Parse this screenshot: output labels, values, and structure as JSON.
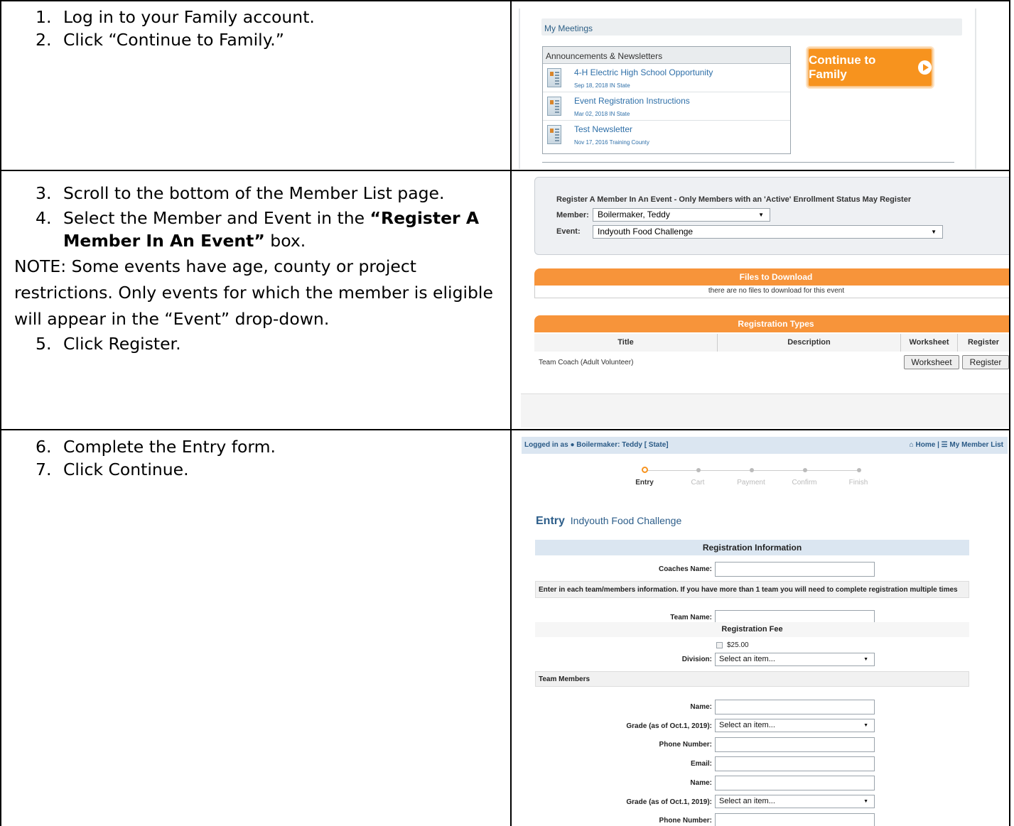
{
  "steps": {
    "s1_num": "1.",
    "s1": "Log in to your Family account.",
    "s2_num": "2.",
    "s2": "Click “Continue to Family.”",
    "s3_num": "3.",
    "s3": "Scroll to the bottom of the Member List page.",
    "s4_num": "4.",
    "s4_pre": "Select the Member and Event in the ",
    "s4_bold": "“Register A Member In An Event”",
    "s4_post": " box.",
    "note": "NOTE: Some events have age, county or project restrictions. Only events for which the member is eligible will appear in the “Event” drop-down.",
    "s5_num": "5.",
    "s5": "Click Register.",
    "s6_num": "6.",
    "s6": "Complete the Entry form.",
    "s7_num": "7.",
    "s7": "Click Continue."
  },
  "shot1": {
    "my_meetings": "My Meetings",
    "announcements_header": "Announcements & Newsletters",
    "items": [
      {
        "title": "4-H Electric High School Opportunity",
        "meta": "Sep 18, 2018 IN State"
      },
      {
        "title": "Event Registration Instructions",
        "meta": "Mar 02, 2018 IN State"
      },
      {
        "title": "Test Newsletter",
        "meta": "Nov 17, 2016 Training County"
      }
    ],
    "continue_button": "Continue to Family"
  },
  "shot2": {
    "register_title": "Register A Member In An Event - Only Members with an 'Active' Enrollment Status May Register",
    "member_label": "Member:",
    "member_value": "Boilermaker, Teddy",
    "event_label": "Event:",
    "event_value": "Indyouth Food Challenge",
    "files_header": "Files to Download",
    "files_msg": "there are no files to download for this event",
    "reg_types_header": "Registration Types",
    "col_title": "Title",
    "col_description": "Description",
    "col_worksheet": "Worksheet",
    "col_register": "Register",
    "row_title": "Team Coach (Adult Volunteer)",
    "worksheet_button": "Worksheet",
    "register_button": "Register"
  },
  "shot3": {
    "logged_in": "Logged in as",
    "user": "Boilermaker: Teddy",
    "role": "[ State]",
    "home": "Home",
    "sep": "|",
    "member_list": "My Member List",
    "progress": [
      "Entry",
      "Cart",
      "Payment",
      "Confirm",
      "Finish"
    ],
    "entry_word": "Entry",
    "entry_event": "Indyouth Food Challenge",
    "reg_info": "Registration Information",
    "coaches_name": "Coaches Name:",
    "team_note": "Enter in each team/members information. If you have more than 1 team you will need to complete registration multiple times",
    "team_name": "Team Name:",
    "reg_fee": "Registration Fee",
    "fee_amount": "$25.00",
    "division": "Division:",
    "select_item": "Select an item...",
    "team_members": "Team Members",
    "name": "Name:",
    "grade": "Grade (as of Oct.1, 2019):",
    "phone": "Phone Number:",
    "email": "Email:"
  },
  "colors": {
    "orange": "#f7931e",
    "link_blue": "#2e6fa8",
    "header_blue": "#dbe6f1"
  }
}
